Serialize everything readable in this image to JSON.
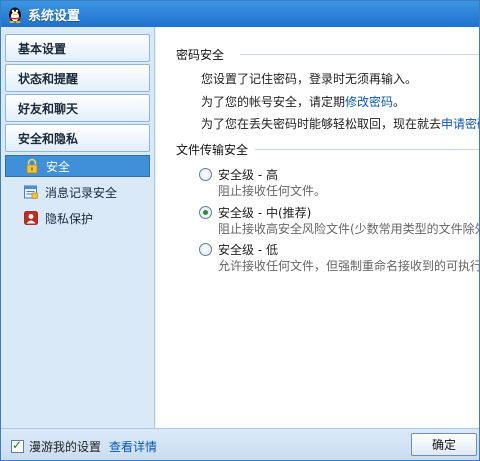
{
  "window": {
    "title": "系统设置"
  },
  "sidebar": {
    "categories": [
      "基本设置",
      "状态和提醒",
      "好友和聊天",
      "安全和隐私"
    ],
    "items": [
      {
        "label": "安全",
        "icon": "lock-icon",
        "selected": true
      },
      {
        "label": "消息记录安全",
        "icon": "message-record-icon",
        "selected": false
      },
      {
        "label": "隐私保护",
        "icon": "privacy-icon",
        "selected": false
      }
    ]
  },
  "content": {
    "password_section": {
      "heading": "密码安全",
      "line1": "您设置了记住密码，登录时无须再输入。",
      "line2_prefix": "为了您的帐号安全，请定期",
      "line2_link": "修改密码",
      "line2_suffix": "。",
      "line3_prefix": "为了您在丢失密码时能够轻松取回，现在就去",
      "line3_link": "申请密码"
    },
    "file_section": {
      "heading": "文件传输安全",
      "options": [
        {
          "label": "安全级 - 高",
          "desc": "阻止接收任何文件。",
          "checked": false
        },
        {
          "label": "安全级 - 中(推荐)",
          "desc": "阻止接收高安全风险文件(少数常用类型的文件除外",
          "checked": true
        },
        {
          "label": "安全级 - 低",
          "desc": "允许接收任何文件，但强制重命名接收到的可执行文",
          "checked": false
        }
      ]
    }
  },
  "bottom": {
    "roam_label": "漫游我的设置",
    "roam_checked": true,
    "details_link": "查看详情",
    "ok_label": "确定"
  },
  "colors": {
    "titlebar": "#1f73cf",
    "selected_item": "#3f8fd9",
    "link": "#0b58b0"
  }
}
